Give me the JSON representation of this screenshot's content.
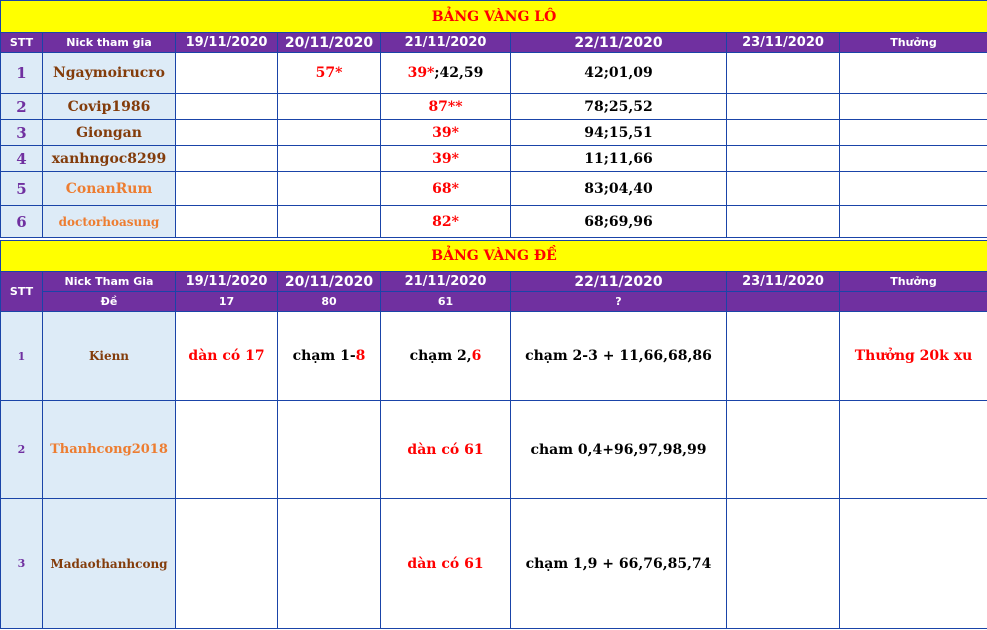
{
  "lo": {
    "title": "BẢNG VÀNG LÔ",
    "headers": {
      "stt": "STT",
      "nick": "Nick tham gia",
      "dates": [
        "19/11/2020",
        "20/11/2020",
        "21/11/2020",
        "22/11/2020",
        "23/11/2020"
      ],
      "reward": "Thưởng"
    },
    "rows": [
      {
        "stt": "1",
        "nick": "Ngaymoirucro",
        "d1": "",
        "d2": "57*",
        "d3a": "39*",
        "d3b": ";42,59",
        "d4": "42;01,09",
        "d5": "",
        "reward": ""
      },
      {
        "stt": "2",
        "nick": "Covip1986",
        "d1": "",
        "d2": "",
        "d3a": "87**",
        "d3b": "",
        "d4": "78;25,52",
        "d5": "",
        "reward": ""
      },
      {
        "stt": "3",
        "nick": "Giongan",
        "d1": "",
        "d2": "",
        "d3a": "39*",
        "d3b": "",
        "d4": "94;15,51",
        "d5": "",
        "reward": ""
      },
      {
        "stt": "4",
        "nick": "xanhngoc8299",
        "d1": "",
        "d2": "",
        "d3a": "39*",
        "d3b": "",
        "d4": "11;11,66",
        "d5": "",
        "reward": ""
      },
      {
        "stt": "5",
        "nick": "ConanRum",
        "d1": "",
        "d2": "",
        "d3a": "68*",
        "d3b": "",
        "d4": "83;04,40",
        "d5": "",
        "reward": ""
      },
      {
        "stt": "6",
        "nick": "doctorhoasung",
        "d1": "",
        "d2": "",
        "d3a": "82*",
        "d3b": "",
        "d4": "68;69,96",
        "d5": "",
        "reward": ""
      }
    ]
  },
  "de": {
    "title": "BẢNG VÀNG ĐỀ",
    "headers": {
      "stt": "STT",
      "nick": "Nick Tham Gia",
      "de_label": "Đề",
      "dates": [
        "19/11/2020",
        "20/11/2020",
        "21/11/2020",
        "22/11/2020",
        "23/11/2020"
      ],
      "results": [
        "17",
        "80",
        "61",
        "?",
        ""
      ],
      "reward": "Thưởng"
    },
    "rows": [
      {
        "stt": "1",
        "nick": "Kienn",
        "d1": "dàn có 17",
        "d2a": "chạm 1-",
        "d2b": "8",
        "d3a": "chạm 2,",
        "d3b": "6",
        "d4": "chạm 2-3 + 11,66,68,86",
        "d5": "",
        "reward": "Thưởng 20k xu"
      },
      {
        "stt": "2",
        "nick": "Thanhcong2018",
        "d1": "",
        "d2a": "",
        "d2b": "",
        "d3a": "dàn có 61",
        "d3b": "",
        "d4": "cham 0,4+96,97,98,99",
        "d5": "",
        "reward": ""
      },
      {
        "stt": "3",
        "nick": "Madaothanhcong",
        "d1": "",
        "d2a": "",
        "d2b": "",
        "d3a": "dàn có 61",
        "d3b": "",
        "d4": "chạm 1,9 + 66,76,85,74",
        "d5": "",
        "reward": ""
      }
    ]
  },
  "colors": {
    "title_bg": "#ffff00",
    "title_text": "#ff0000",
    "header_bg": "#7030a0",
    "header_text": "#ffffff",
    "name_bg": "#ddebf7",
    "grid": "#1a44a8",
    "brown": "#833c0b",
    "orange": "#ed7d31",
    "red": "#ff0000"
  }
}
